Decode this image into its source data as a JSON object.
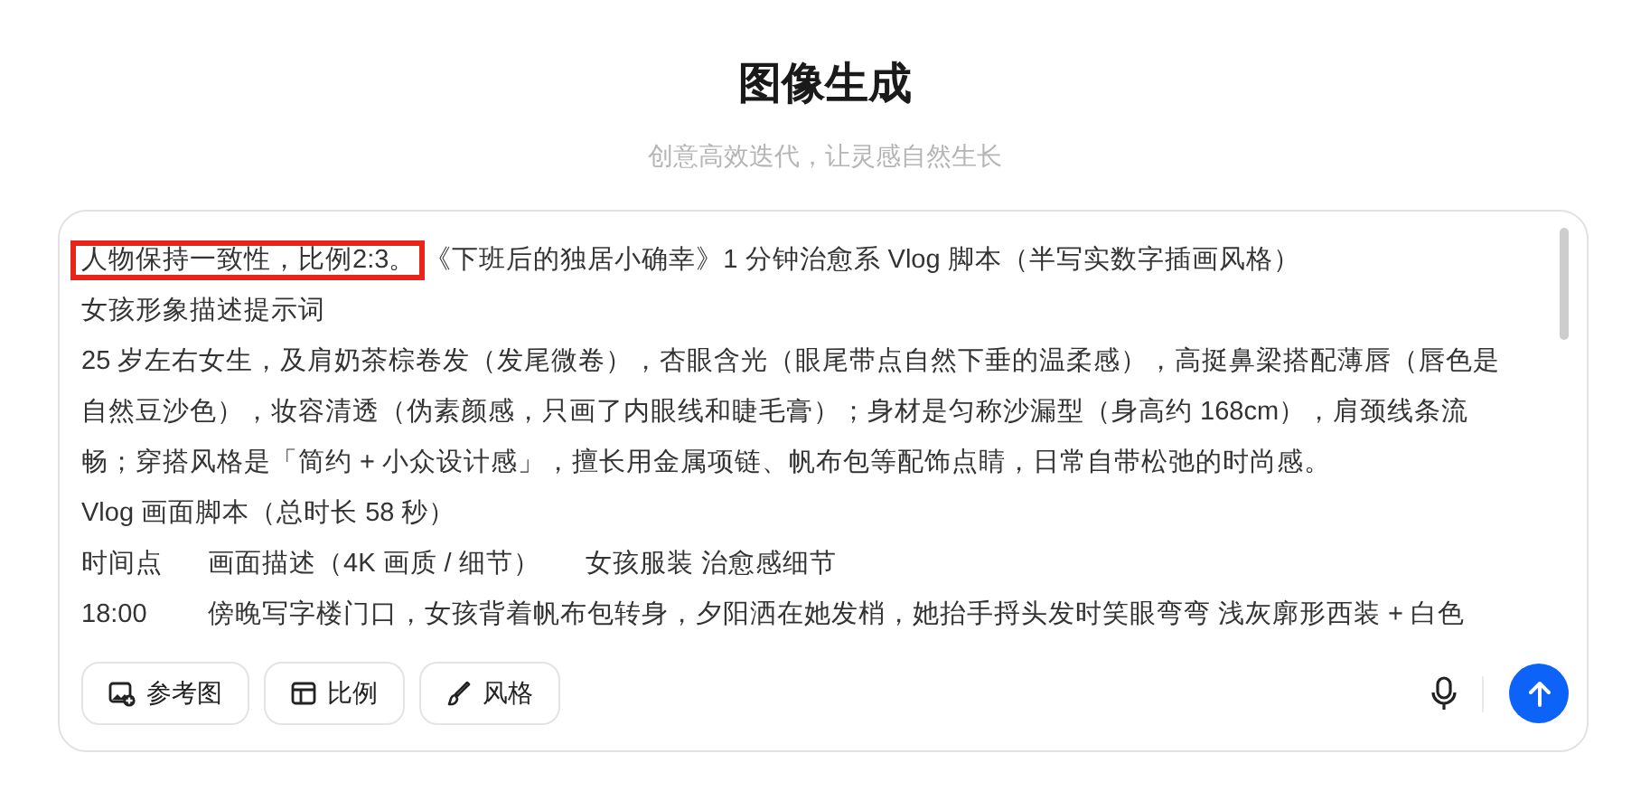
{
  "header": {
    "title": "图像生成",
    "subtitle": "创意高效迭代，让灵感自然生长"
  },
  "prompt": {
    "blocks": [
      {
        "kind": "highlighted",
        "highlight": "人物保持一致性，比例2:3。",
        "text": "《下班后的独居小确幸》1 分钟治愈系 Vlog 脚本（半写实数字插画风格）"
      },
      {
        "kind": "line",
        "text": "女孩形象描述提示词"
      },
      {
        "kind": "line",
        "text": "25 岁左右女生，及肩奶茶棕卷发（发尾微卷），杏眼含光（眼尾带点自然下垂的温柔感），高挺鼻梁搭配薄唇（唇色是自然豆沙色），妆容清透（伪素颜感，只画了内眼线和睫毛膏）；身材是匀称沙漏型（身高约 168cm），肩颈线条流畅；穿搭风格是「简约 + 小众设计感」，擅长用金属项链、帆布包等配饰点睛，日常自带松弛的时尚感。"
      },
      {
        "kind": "line",
        "text": "Vlog 画面脚本（总时长 58 秒）"
      },
      {
        "kind": "columns",
        "cells": [
          "时间点",
          "画面描述（4K 画质 / 细节）",
          "女孩服装 治愈感细节"
        ]
      },
      {
        "kind": "columns",
        "cells": [
          "18:00",
          "傍晚写字楼门口，女孩背着帆布包转身，夕阳洒在她发梢，她抬手捋头发时笑眼弯弯 浅灰廓形西装 + 白色"
        ]
      }
    ]
  },
  "tools": [
    {
      "kind": "image",
      "label": "参考图"
    },
    {
      "kind": "ratio",
      "label": "比例"
    },
    {
      "kind": "style",
      "label": "风格"
    }
  ]
}
